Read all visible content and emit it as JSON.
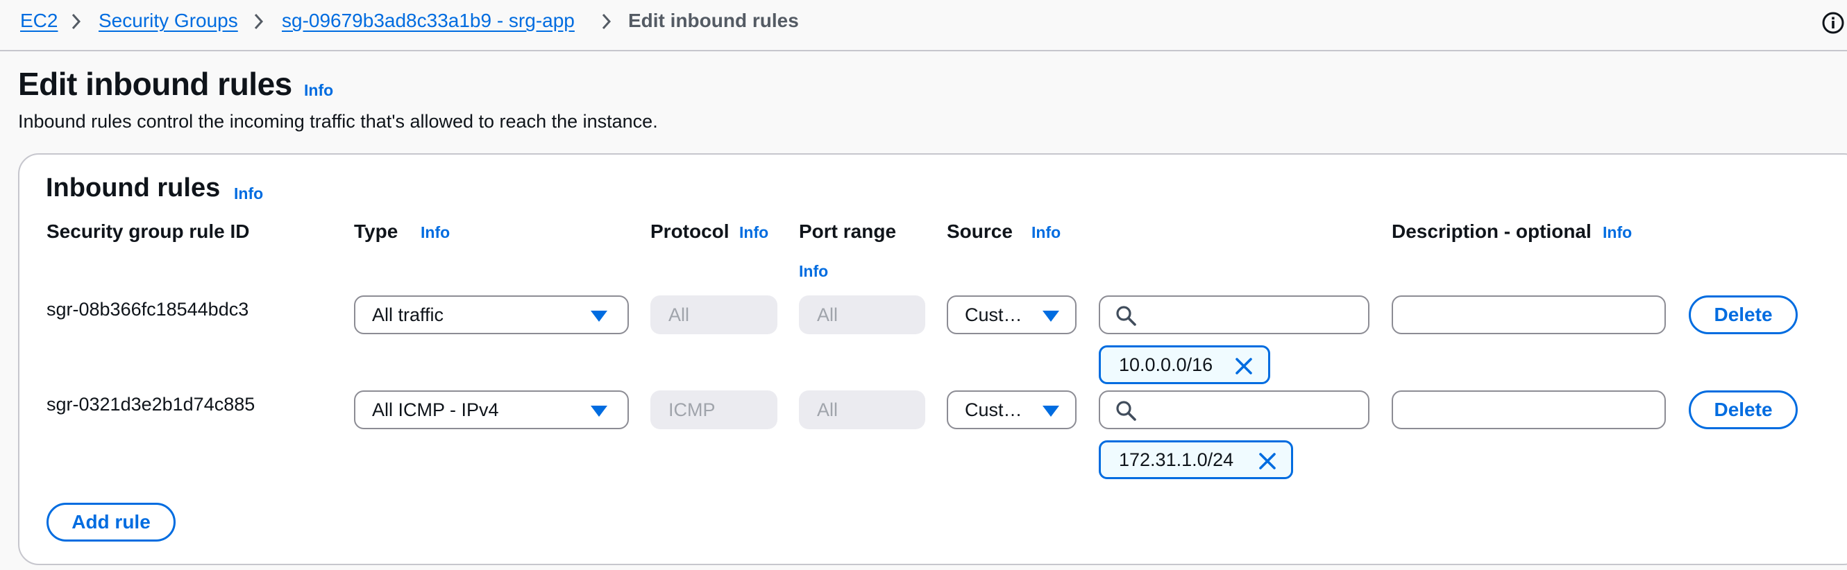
{
  "breadcrumb": {
    "items": [
      "EC2",
      "Security Groups",
      "sg-09679b3ad8c33a1b9 - srg-app"
    ],
    "current": "Edit inbound rules"
  },
  "header": {
    "title": "Edit inbound rules",
    "info": "Info",
    "description": "Inbound rules control the incoming traffic that's allowed to reach the instance."
  },
  "panel": {
    "title": "Inbound rules",
    "info": "Info",
    "columns": {
      "rule_id": "Security group rule ID",
      "type": "Type",
      "protocol": "Protocol",
      "port_range": "Port range",
      "source": "Source",
      "description": "Description - optional",
      "info": "Info"
    },
    "rules": [
      {
        "id": "sgr-08b366fc18544bdc3",
        "type": "All traffic",
        "protocol": "All",
        "port_range": "All",
        "source_type": "Cust…",
        "search_value": "",
        "cidr": "10.0.0.0/16",
        "description": "",
        "delete_label": "Delete"
      },
      {
        "id": "sgr-0321d3e2b1d74c885",
        "type": "All ICMP - IPv4",
        "protocol": "ICMP",
        "port_range": "All",
        "source_type": "Cust…",
        "search_value": "",
        "cidr": "172.31.1.0/24",
        "description": "",
        "delete_label": "Delete"
      }
    ],
    "add_rule_label": "Add rule"
  },
  "colors": {
    "link": "#006ce0",
    "border": "#8c8c94",
    "disabled_bg": "#ebebf0"
  }
}
